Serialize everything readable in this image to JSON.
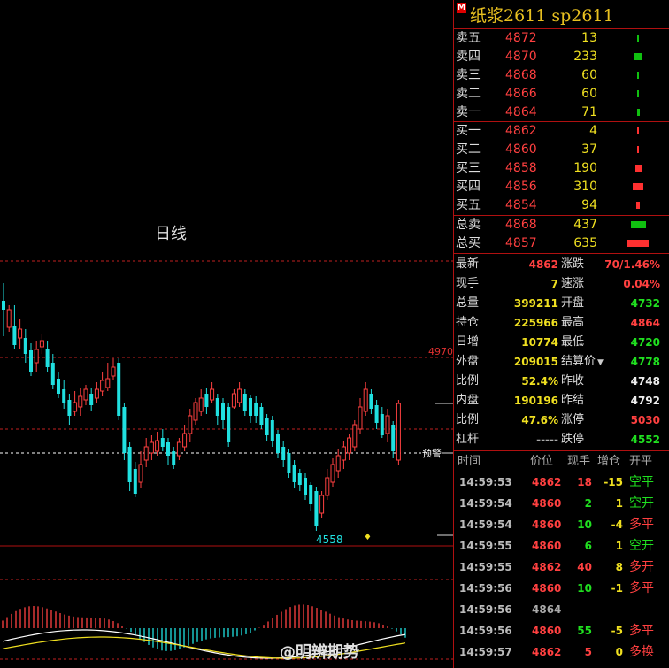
{
  "chart": {
    "label": "日线",
    "price_tag_high": "4970",
    "low_label": "4558",
    "alert_label": "预警"
  },
  "header": {
    "badge": "M",
    "title": "纸浆2611  sp2611"
  },
  "orderbook": {
    "asks": [
      {
        "label": "卖五",
        "price": "4872",
        "volume": "13"
      },
      {
        "label": "卖四",
        "price": "4870",
        "volume": "233"
      },
      {
        "label": "卖三",
        "price": "4868",
        "volume": "60"
      },
      {
        "label": "卖二",
        "price": "4866",
        "volume": "60"
      },
      {
        "label": "卖一",
        "price": "4864",
        "volume": "71"
      }
    ],
    "bids": [
      {
        "label": "买一",
        "price": "4862",
        "volume": "4"
      },
      {
        "label": "买二",
        "price": "4860",
        "volume": "37"
      },
      {
        "label": "买三",
        "price": "4858",
        "volume": "190"
      },
      {
        "label": "买四",
        "price": "4856",
        "volume": "310"
      },
      {
        "label": "买五",
        "price": "4854",
        "volume": "94"
      }
    ],
    "totals": [
      {
        "label": "总卖",
        "price": "4868",
        "volume": "437"
      },
      {
        "label": "总买",
        "price": "4857",
        "volume": "635"
      }
    ]
  },
  "stats": [
    {
      "l1": "最新",
      "v1": "4862",
      "c1": "red",
      "l2": "涨跌",
      "v2": "70/1.46%",
      "c2": "red"
    },
    {
      "l1": "现手",
      "v1": "7",
      "c1": "yellow",
      "l2": "速涨",
      "v2": "0.04%",
      "c2": "red"
    },
    {
      "l1": "总量",
      "v1": "399211",
      "c1": "yellow",
      "l2": "开盘",
      "v2": "4732",
      "c2": "green"
    },
    {
      "l1": "持仓",
      "v1": "225966",
      "c1": "yellow",
      "l2": "最高",
      "v2": "4864",
      "c2": "red"
    },
    {
      "l1": "日增",
      "v1": "10774",
      "c1": "yellow",
      "l2": "最低",
      "v2": "4720",
      "c2": "green"
    },
    {
      "l1": "外盘",
      "v1": "209015",
      "c1": "yellow",
      "l2": "结算价",
      "v2": "4778",
      "c2": "green"
    },
    {
      "l1": "比例",
      "v1": "52.4%",
      "c1": "yellow",
      "l2": "昨收",
      "v2": "4748",
      "c2": "white"
    },
    {
      "l1": "内盘",
      "v1": "190196",
      "c1": "yellow",
      "l2": "昨结",
      "v2": "4792",
      "c2": "white"
    },
    {
      "l1": "比例",
      "v1": "47.6%",
      "c1": "yellow",
      "l2": "涨停",
      "v2": "5030",
      "c2": "red"
    },
    {
      "l1": "杠杆",
      "v1": "-----",
      "c1": "gray",
      "l2": "跌停",
      "v2": "4552",
      "c2": "green"
    }
  ],
  "ticks_header": {
    "time": "时间",
    "price": "价位",
    "qty": "现手",
    "oi": "增仓",
    "type": "开平"
  },
  "ticks": [
    {
      "time": "14:59:53",
      "price": "4862",
      "pc": "red",
      "qty": "18",
      "qc": "red",
      "oi": "-15",
      "type": "空平",
      "tc": "green"
    },
    {
      "time": "14:59:54",
      "price": "4860",
      "pc": "red",
      "qty": "2",
      "qc": "green",
      "oi": "1",
      "type": "空开",
      "tc": "green"
    },
    {
      "time": "14:59:54",
      "price": "4860",
      "pc": "red",
      "qty": "10",
      "qc": "green",
      "oi": "-4",
      "type": "多平",
      "tc": "red"
    },
    {
      "time": "14:59:55",
      "price": "4860",
      "pc": "red",
      "qty": "6",
      "qc": "green",
      "oi": "1",
      "type": "空开",
      "tc": "green"
    },
    {
      "time": "14:59:55",
      "price": "4862",
      "pc": "red",
      "qty": "40",
      "qc": "red",
      "oi": "8",
      "type": "多开",
      "tc": "red"
    },
    {
      "time": "14:59:56",
      "price": "4860",
      "pc": "red",
      "qty": "10",
      "qc": "green",
      "oi": "-1",
      "type": "多平",
      "tc": "red"
    },
    {
      "time": "14:59:56",
      "price": "4864",
      "pc": "gray",
      "qty": "",
      "qc": "gray",
      "oi": "",
      "type": "",
      "tc": "gray"
    },
    {
      "time": "14:59:56",
      "price": "4860",
      "pc": "red",
      "qty": "55",
      "qc": "green",
      "oi": "-5",
      "type": "多平",
      "tc": "red"
    },
    {
      "time": "14:59:57",
      "price": "4862",
      "pc": "red",
      "qty": "5",
      "qc": "red",
      "oi": "0",
      "type": "多换",
      "tc": "red"
    }
  ],
  "watermark": "@明辨期势",
  "colors": {
    "up": "#ff4040",
    "down": "#20e0e0",
    "panel_border": "#b01010",
    "title": "#e8c020"
  }
}
